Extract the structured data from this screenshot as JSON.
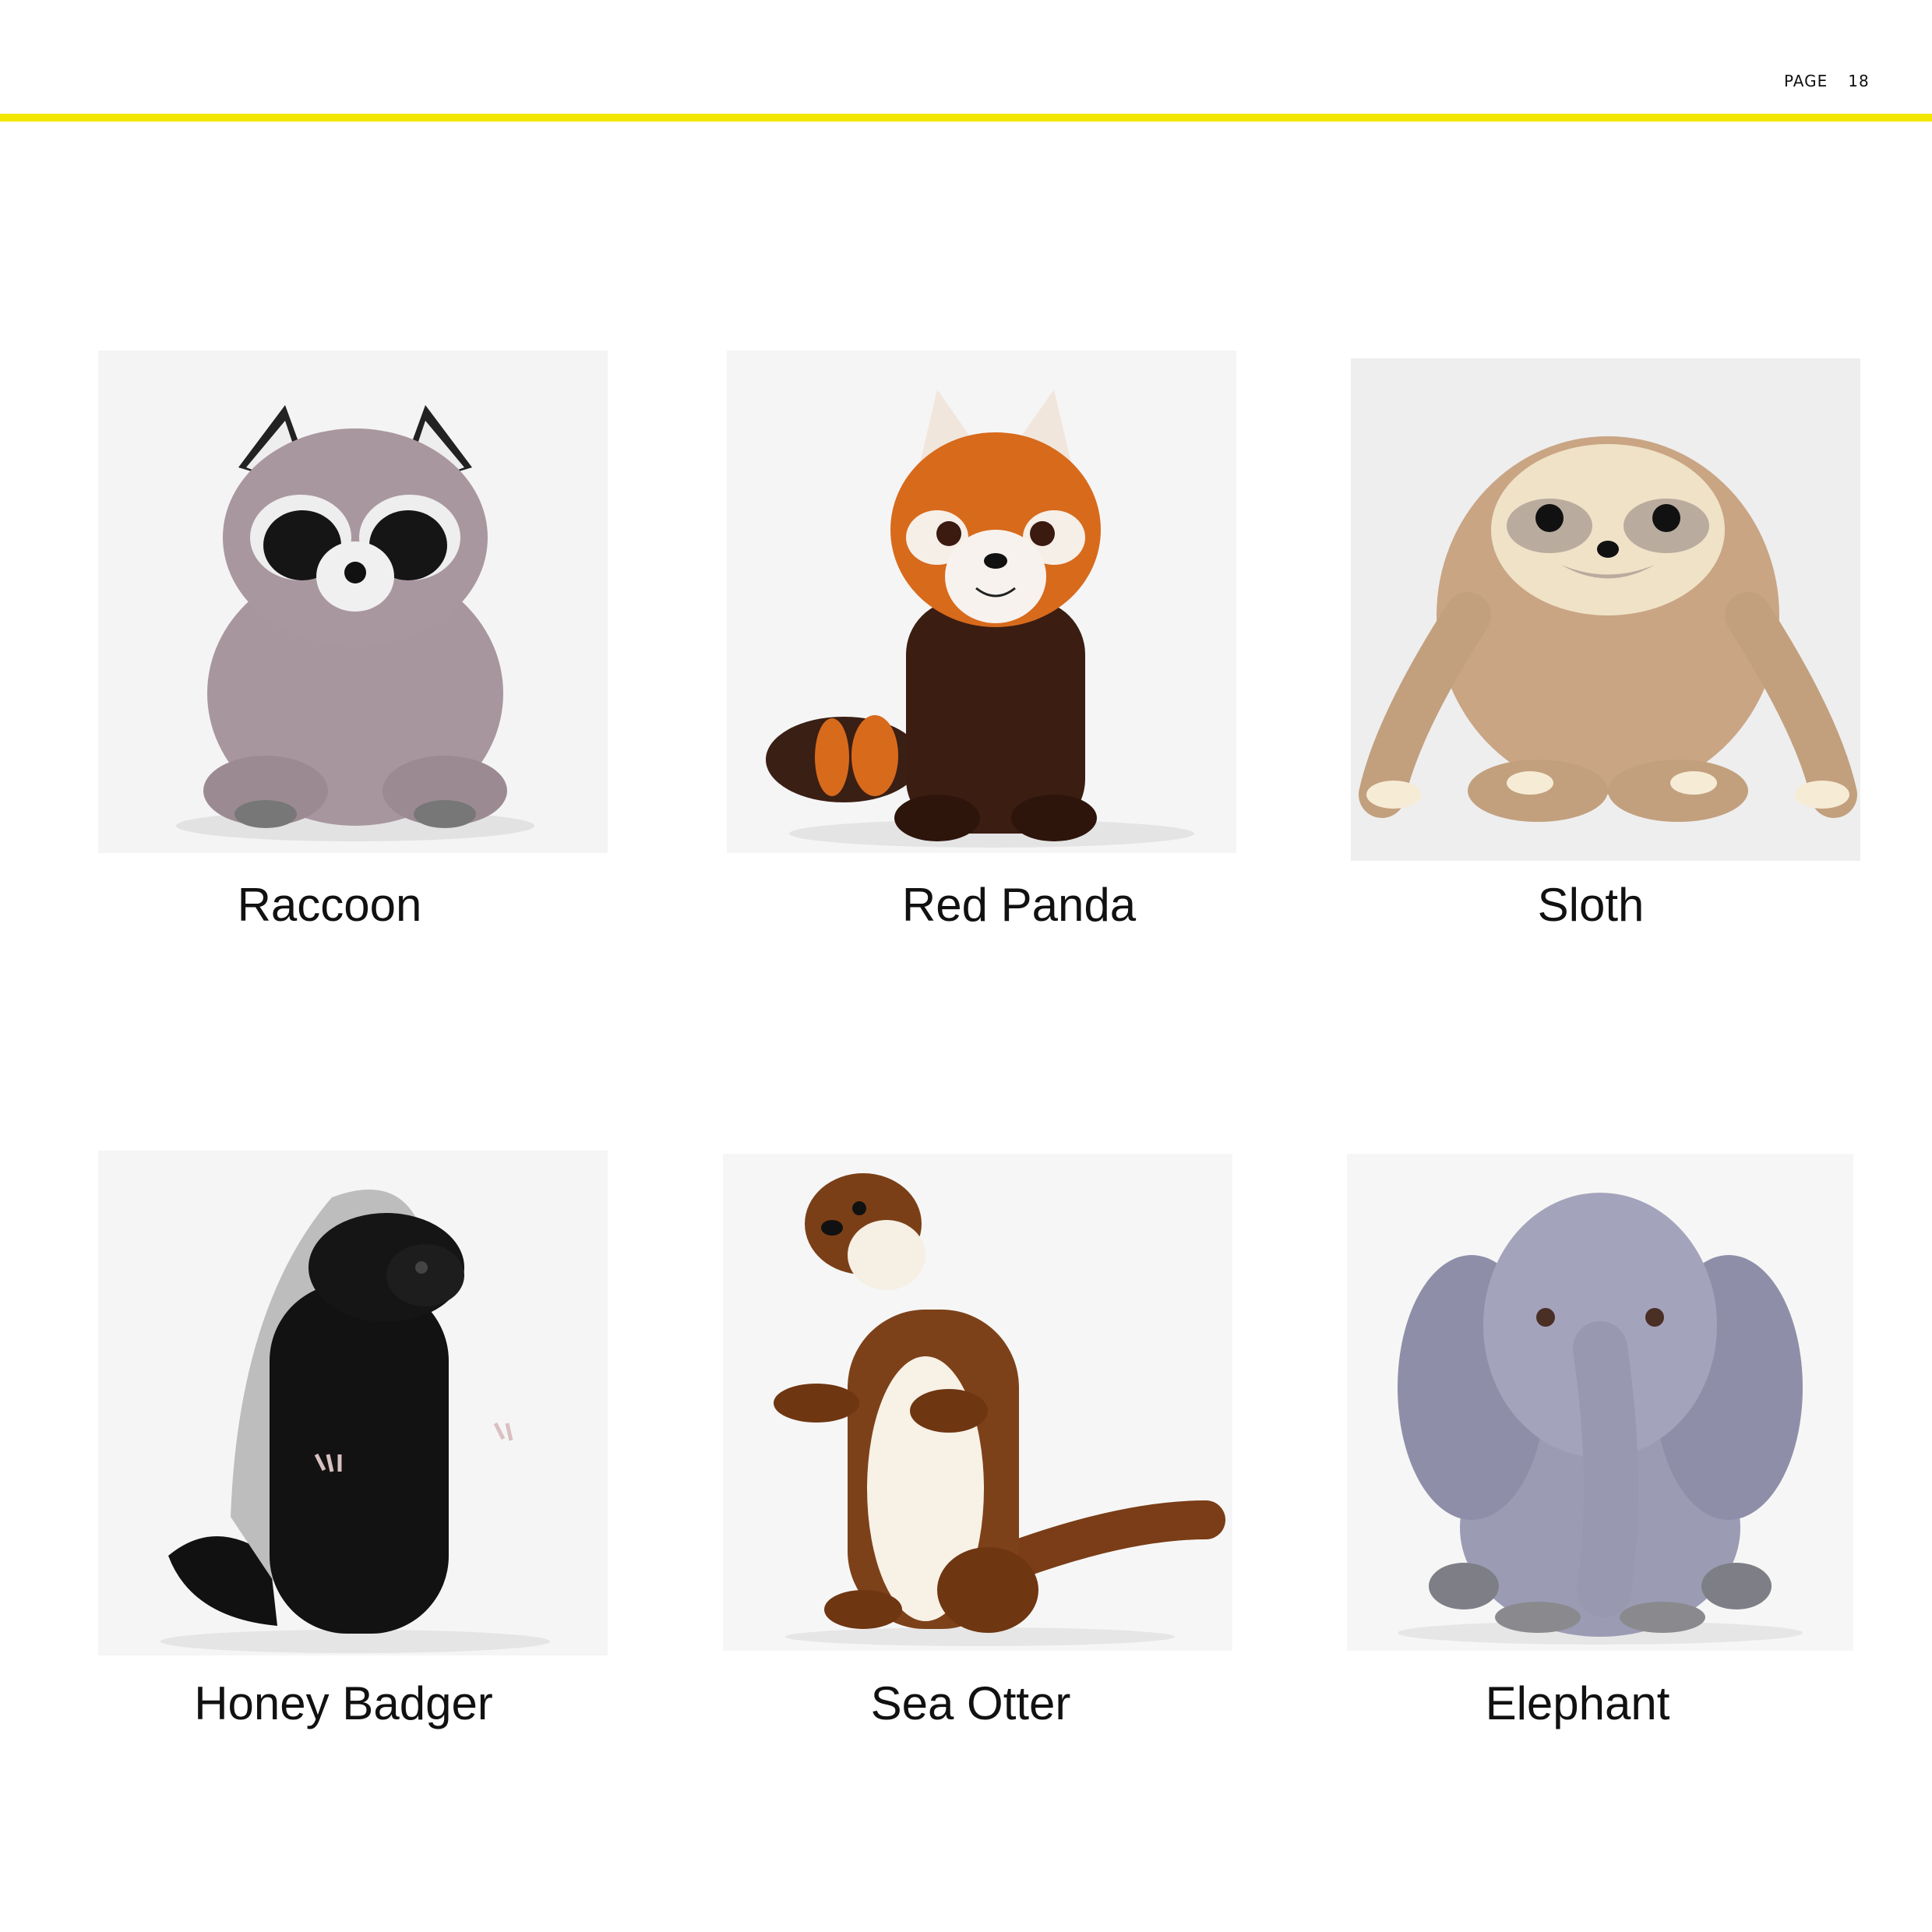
{
  "header": {
    "page_label": "PAGE",
    "page_number": "18",
    "rule_color": "#f3e600"
  },
  "products": [
    {
      "name": "Raccoon",
      "icon": "raccoon-plush-photo"
    },
    {
      "name": "Red Panda",
      "icon": "red-panda-plush-photo"
    },
    {
      "name": "Sloth",
      "icon": "sloth-plush-photo"
    },
    {
      "name": "Honey Badger",
      "icon": "honey-badger-plush-photo"
    },
    {
      "name": "Sea Otter",
      "icon": "sea-otter-plush-photo"
    },
    {
      "name": "Elephant",
      "icon": "elephant-plush-photo"
    }
  ]
}
